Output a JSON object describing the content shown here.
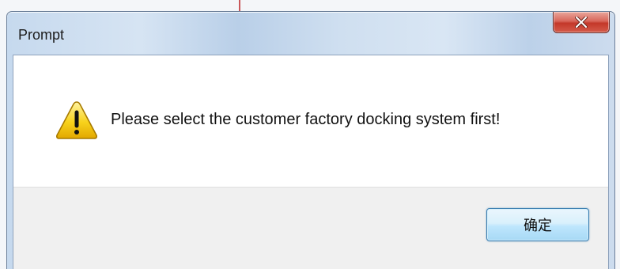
{
  "dialog": {
    "title": "Prompt",
    "message": "Please select the customer factory docking system first!",
    "icon": "warning-icon",
    "close_icon": "close-icon"
  },
  "buttons": {
    "ok_label": "确定"
  },
  "colors": {
    "close_button": "#c4382a",
    "ok_button_border": "#3c7fb1",
    "warning_yellow": "#f5c400"
  }
}
